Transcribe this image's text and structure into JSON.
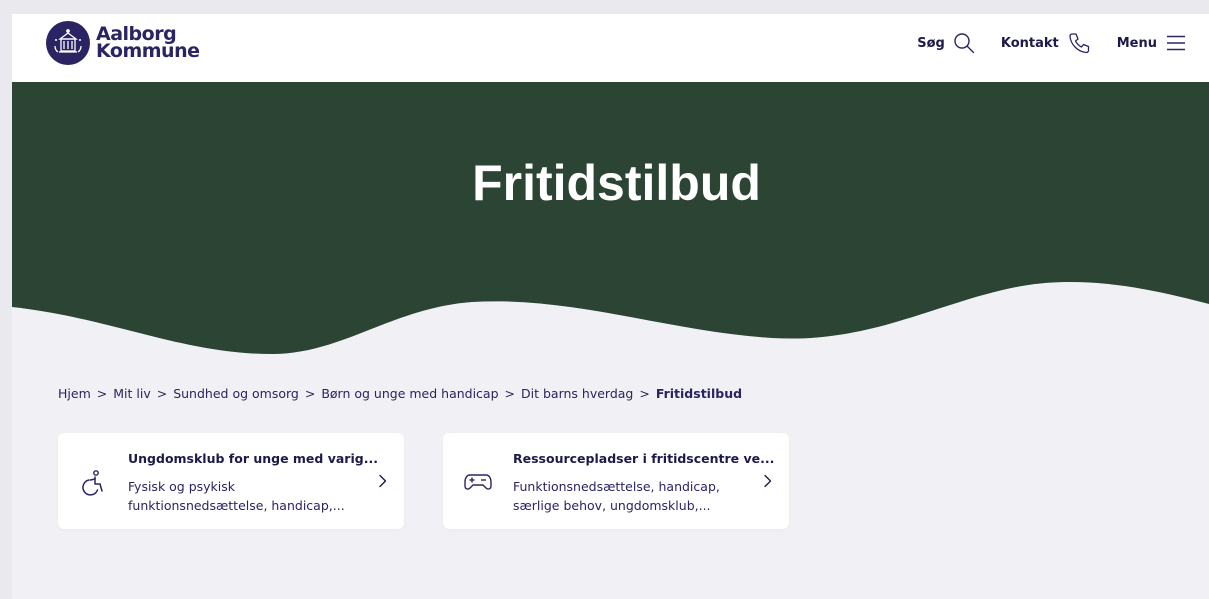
{
  "header": {
    "logo_line1": "Aalborg",
    "logo_line2": "Kommune",
    "nav": [
      {
        "label": "Søg",
        "icon": "search-icon"
      },
      {
        "label": "Kontakt",
        "icon": "phone-icon"
      },
      {
        "label": "Menu",
        "icon": "hamburger-menu-icon"
      }
    ]
  },
  "hero": {
    "title": "Fritidstilbud"
  },
  "breadcrumb": {
    "items": [
      "Hjem",
      "Mit liv",
      "Sundhed og omsorg",
      "Børn og unge med handicap",
      "Dit barns hverdag"
    ],
    "separator": ">",
    "current": "Fritidstilbud"
  },
  "cards": [
    {
      "title": "Ungdomsklub for unge med varig...",
      "desc_line1": "Fysisk og psykisk",
      "desc_line2": "funktionsnedsættelse, handicap,...",
      "icon": "wheelchair-icon"
    },
    {
      "title": "Ressourcepladser i fritidscentre ve...",
      "desc_line1": "Funktionsnedsættelse, handicap,",
      "desc_line2": "særlige behov, ungdomsklub,...",
      "icon": "game-controller-icon"
    }
  ],
  "colors": {
    "brand": "#2a2462",
    "hero_bg": "#2c4433",
    "page_bg": "#f1f0f5",
    "card_bg": "#ffffff"
  }
}
